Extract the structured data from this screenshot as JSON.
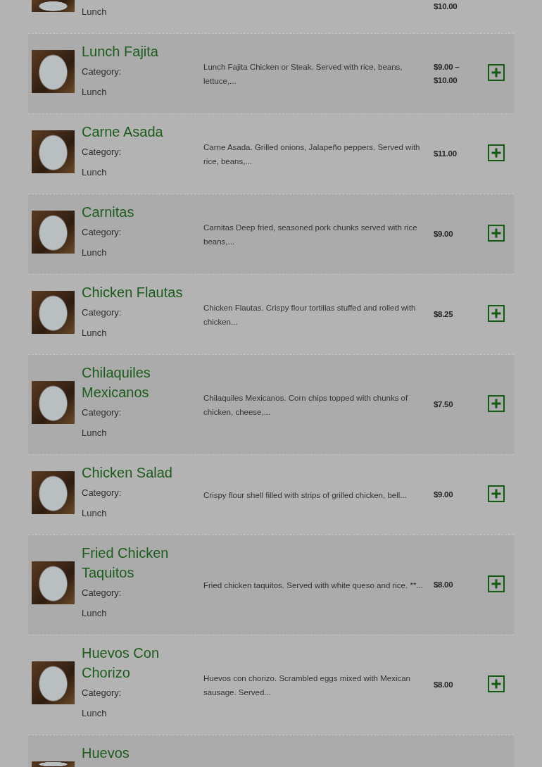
{
  "menu_items": [
    {
      "kind": "cut_top",
      "category": "Lunch",
      "price": "$10.00"
    },
    {
      "kind": "full",
      "name": "Lunch Fajita",
      "category_label": "Category:",
      "category": "Lunch",
      "description": "Lunch Fajita Chicken or Steak. Served with rice, beans, lettuce,...",
      "price": "$9.00 – $10.00"
    },
    {
      "kind": "full",
      "name": "Carne Asada",
      "category_label": "Category:",
      "category": "Lunch",
      "description": "Carne Asada. Grilled onions, Jalapeño peppers. Served with rice, beans,...",
      "price": "$11.00"
    },
    {
      "kind": "full",
      "name": "Carnitas",
      "category_label": "Category:",
      "category": "Lunch",
      "description": "Carnitas Deep fried, seasoned pork chunks served with rice beans,...",
      "price": "$9.00"
    },
    {
      "kind": "full",
      "name": "Chicken Flautas",
      "category_label": "Category:",
      "category": "Lunch",
      "description": "Chicken Flautas. Crispy flour tortillas stuffed and rolled with chicken...",
      "price": "$8.25"
    },
    {
      "kind": "full",
      "name": "Chilaquiles Mexicanos",
      "category_label": "Category:",
      "category": "Lunch",
      "description": "Chilaquiles Mexicanos. Corn chips topped with chunks of chicken, cheese,...",
      "price": "$7.50"
    },
    {
      "kind": "full",
      "name": "Chicken Salad",
      "category_label": "Category:",
      "category": "Lunch",
      "description": "Crispy flour shell filled with strips of grilled chicken, bell...",
      "price": "$9.00"
    },
    {
      "kind": "full",
      "name": "Fried Chicken Taquitos",
      "category_label": "Category:",
      "category": "Lunch",
      "description": "Fried chicken taquitos. Served with white queso and rice. **...",
      "price": "$8.00"
    },
    {
      "kind": "full",
      "name": "Huevos Con Chorizo",
      "category_label": "Category:",
      "category": "Lunch",
      "description": "Huevos con chorizo. Scrambled eggs mixed with Mexican sausage. Served...",
      "price": "$8.00"
    },
    {
      "kind": "cut_bottom",
      "name": "Huevos"
    }
  ]
}
